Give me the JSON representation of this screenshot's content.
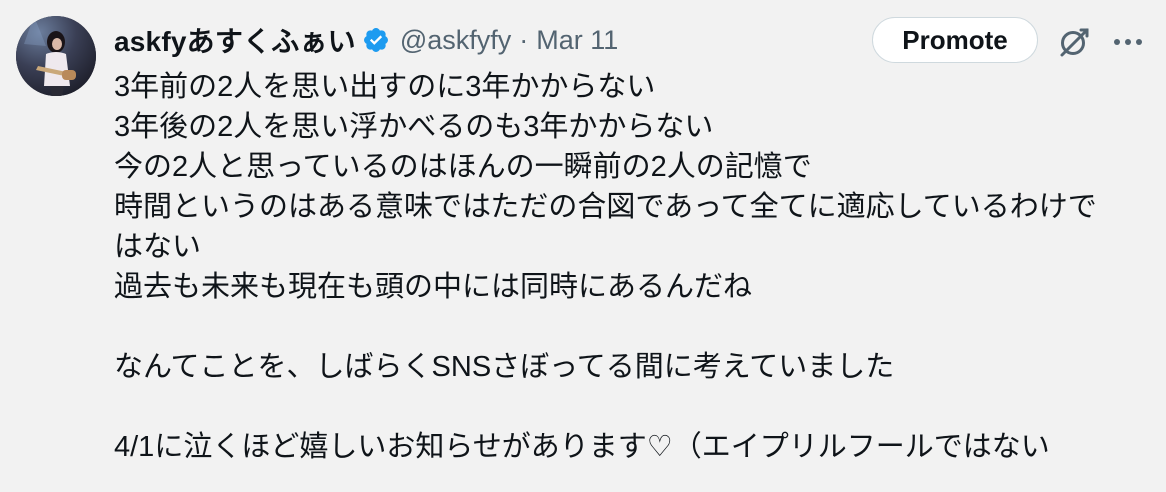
{
  "tweet": {
    "author": {
      "display_name": "askfyあすくふぁい",
      "handle": "@askfyfy",
      "verified": true
    },
    "separator": "·",
    "date": "Mar 11",
    "actions": {
      "promote_label": "Promote",
      "grok_icon": "grok-icon",
      "more_icon": "more-icon"
    },
    "text_lines": [
      "3年前の2人を思い出すのに3年かからない",
      "3年後の2人を思い浮かべるのも3年かからない",
      "今の2人と思っているのはほんの一瞬前の2人の記憶で",
      "時間というのはある意味ではただの合図であって全てに適応しているわけで",
      "はない",
      "過去も未来も現在も頭の中には同時にあるんだね",
      "",
      "なんてことを、しばらくSNSさぼってる間に考えていました",
      "",
      "4/1に泣くほど嬉しいお知らせがあります♡（エイプリルフールではない"
    ]
  },
  "colors": {
    "background": "#f2f2f2",
    "text_primary": "#0f1419",
    "text_secondary": "#536471",
    "verified_blue": "#1d9bf0",
    "button_border": "#cfd9de"
  }
}
